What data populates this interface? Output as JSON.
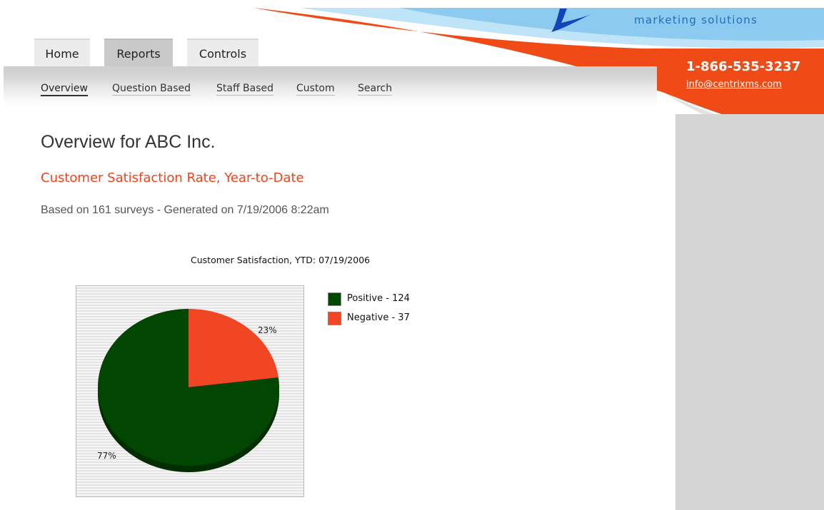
{
  "header": {
    "tagline": "marketing solutions",
    "phone": "1-866-535-3237",
    "email": "info@centrixms.com",
    "accent_orange": "#f04a16",
    "accent_blue": "#5ab4e6"
  },
  "nav": {
    "tabs": [
      {
        "label": "Home",
        "active": false
      },
      {
        "label": "Reports",
        "active": true
      },
      {
        "label": "Controls",
        "active": false
      }
    ],
    "subnav": [
      {
        "label": "Overview",
        "current": true
      },
      {
        "label": "Question Based",
        "current": false
      },
      {
        "label": "Staff Based",
        "current": false
      },
      {
        "label": "Custom",
        "current": false
      },
      {
        "label": "Search",
        "current": false
      }
    ]
  },
  "main": {
    "title": "Overview for ABC Inc.",
    "section_title": "Customer Satisfaction Rate, Year-to-Date",
    "subinfo": "Based on 161 surveys - Generated on 7/19/2006 8:22am"
  },
  "chart_data": {
    "type": "pie",
    "title": "Customer Satisfaction, YTD: 07/19/2006",
    "slices": [
      {
        "label": "Positive - 124",
        "name": "Positive",
        "value": 124,
        "percent_label": "77%",
        "color": "#014601"
      },
      {
        "label": "Negative - 37",
        "name": "Negative",
        "value": 37,
        "percent_label": "23%",
        "color": "#f04624"
      }
    ],
    "legend_position": "right",
    "three_d": true
  }
}
